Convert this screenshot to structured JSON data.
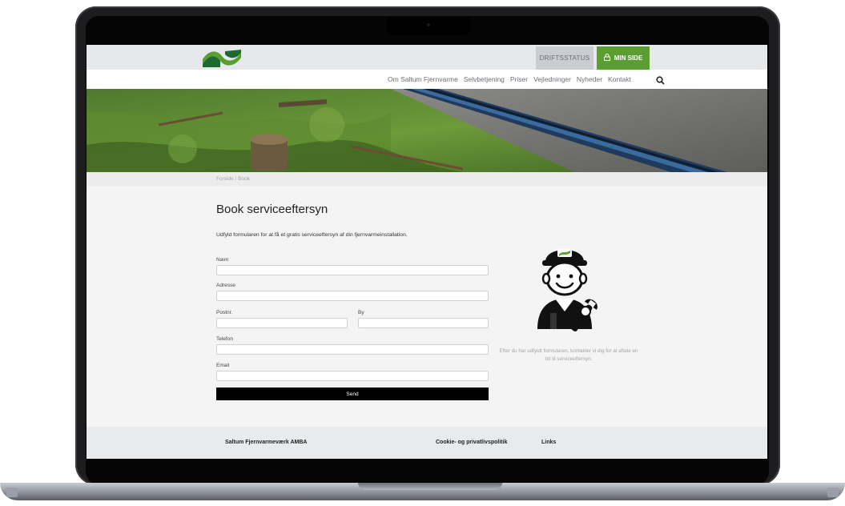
{
  "header": {
    "status_label": "DRIFTSSTATUS",
    "minside_label": "MIN SIDE",
    "logo_icon": "saltum-logo-icon",
    "lock_icon": "lock-icon"
  },
  "nav": {
    "items": [
      "Om Saltum Fjernvarme",
      "Selvbetjening",
      "Priser",
      "Vejledninger",
      "Nyheder",
      "Kontakt"
    ],
    "search_icon": "search-icon"
  },
  "breadcrumb": {
    "home": "Forside",
    "separator": "/",
    "current": "Book"
  },
  "page": {
    "title": "Book serviceeftersyn",
    "intro": "Udfyld formularen for at få et gratis serviceeftersyn af din fjernvarmeinstallation."
  },
  "form": {
    "name_label": "Navn",
    "address_label": "Adresse",
    "zip_label": "Postnr.",
    "city_label": "By",
    "phone_label": "Telefon",
    "email_label": "Email",
    "submit_label": "Send"
  },
  "aside": {
    "text": "Efter du har udfyldt formularen, kontakter vi dig for at aftale en tid til serviceeftersyn."
  },
  "footer": {
    "company": "Saltum Fjernvarmeværk AMBA",
    "cookie": "Cookie- og privatlivspolitik",
    "links": "Links"
  },
  "colors": {
    "brand_green": "#5a9e32",
    "dark_green": "#1b6a2f",
    "button_black": "#000000"
  }
}
